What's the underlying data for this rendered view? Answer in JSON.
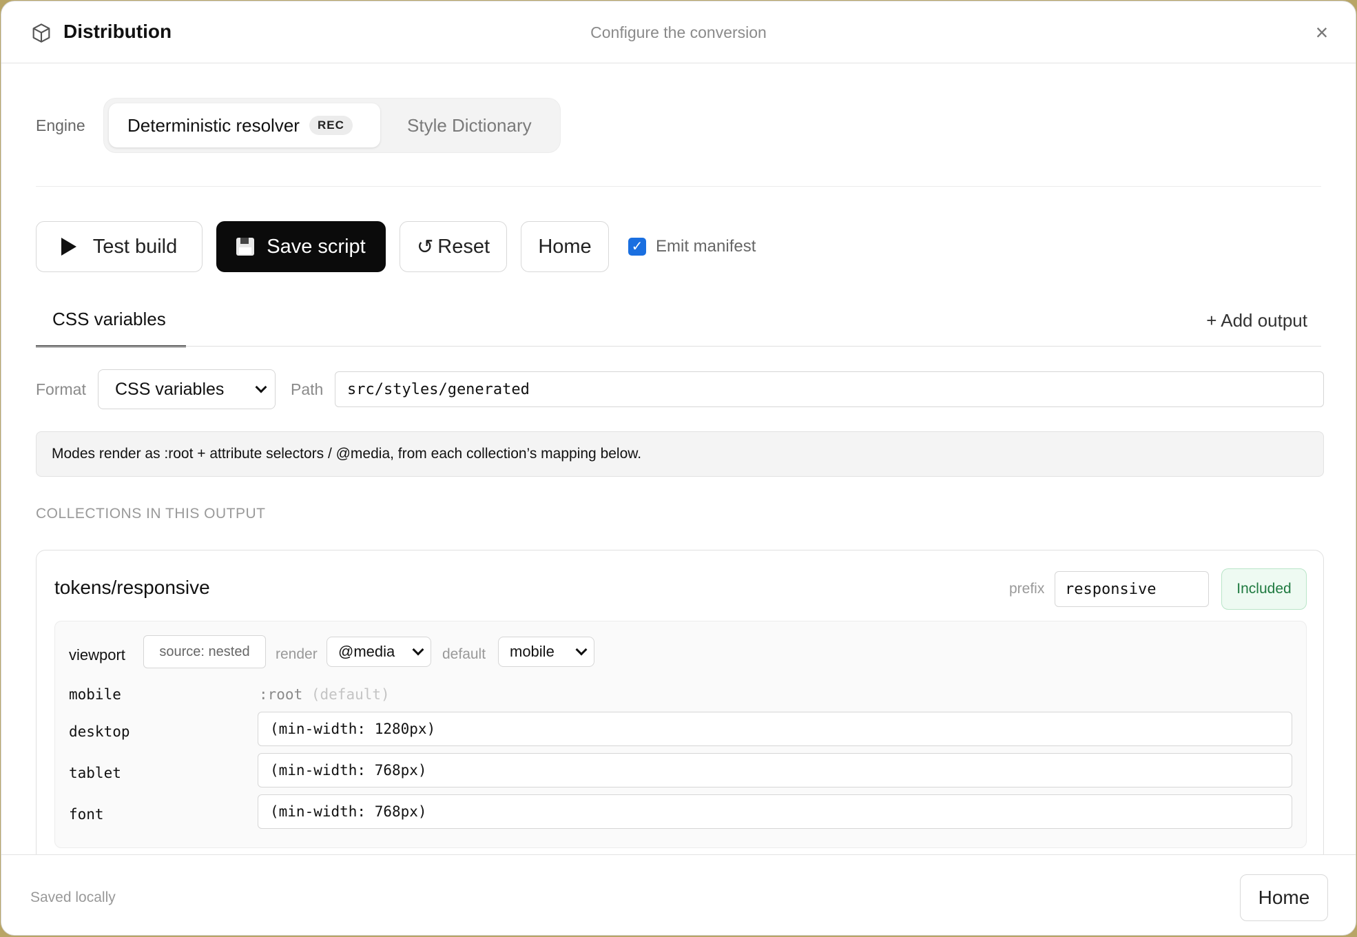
{
  "header": {
    "title": "Distribution",
    "subtitle": "Configure the conversion",
    "close_glyph": "×"
  },
  "engine": {
    "label": "Engine",
    "options": [
      {
        "label": "Deterministic resolver",
        "badge": "REC",
        "selected": true
      },
      {
        "label": "Style Dictionary",
        "selected": false
      }
    ]
  },
  "toolbar": {
    "test_label": "Test build",
    "save_label": "Save script",
    "reset_label": "Reset",
    "reset_glyph": "↺",
    "home_label": "Home",
    "manifest_label": "Emit manifest",
    "manifest_checked": true
  },
  "tabs": {
    "active": "CSS variables",
    "add_label": "+ Add output"
  },
  "output": {
    "format_label": "Format",
    "format_value": "CSS variables",
    "path_label": "Path",
    "path_value": "src/styles/generated",
    "note": "Modes render as :root + attribute selectors / @media, from each collection’s mapping below."
  },
  "collections": {
    "section_title": "COLLECTIONS IN THIS OUTPUT",
    "items": [
      {
        "name": "tokens/responsive",
        "prefix_label": "prefix",
        "prefix_value": "responsive",
        "status": "Included",
        "group": {
          "name": "viewport",
          "source": "source: nested",
          "render_label": "render",
          "render_value": "@media",
          "default_label": "default",
          "default_value": "mobile",
          "modes": [
            {
              "name": "mobile",
              "root": ":root",
              "root_note": "(default)"
            },
            {
              "name": "desktop",
              "query": "(min-width: 1280px)"
            },
            {
              "name": "tablet",
              "query": "(min-width: 768px)"
            },
            {
              "name": "font",
              "query": "(min-width: 768px)"
            }
          ]
        }
      }
    ]
  },
  "footer": {
    "status": "Saved locally",
    "home_label": "Home"
  },
  "colors": {
    "primary_button": "#0b0b0b",
    "checkbox": "#1a6fe0",
    "included_text": "#1f7a40",
    "included_bg": "#eefaf2"
  },
  "icons": {
    "header": "cube-icon",
    "close": "close-icon",
    "test": "play-icon",
    "save": "floppy-disk-icon",
    "reset": "reset-icon",
    "checkbox": "checkmark-icon",
    "select": "chevron-down-icon"
  }
}
